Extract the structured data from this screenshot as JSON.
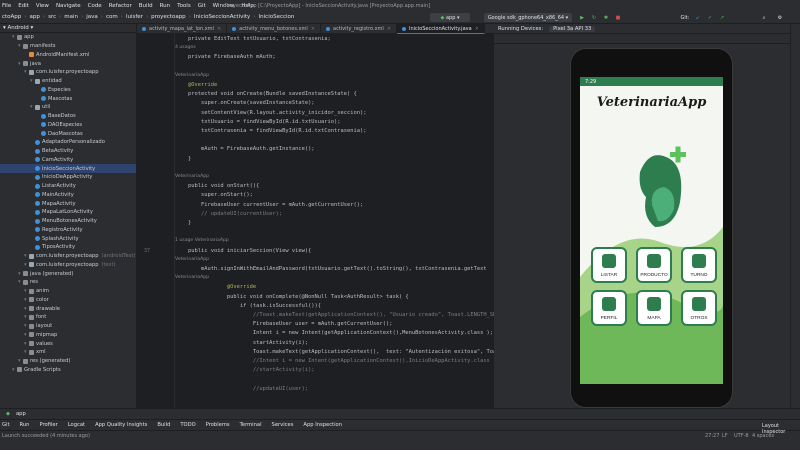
{
  "menubar": {
    "items": [
      "ctoApp",
      "app",
      "src",
      "main",
      "java",
      "com",
      "luisfer",
      "proyectoapp",
      "InicioSeccionActivity",
      "InicioSeccion"
    ],
    "title": "ProyectoApp [C:\\ProyectoApp] - InicioSeccionActivity.java [ProyectoApp.app.main]"
  },
  "menus": [
    "File",
    "Edit",
    "View",
    "Navigate",
    "Code",
    "Refactor",
    "Build",
    "Run",
    "Tools",
    "Git",
    "Window",
    "Help"
  ],
  "toolbar": {
    "crumbs": [
      "ctoApp",
      "app",
      "src",
      "main",
      "java",
      "com",
      "luisfer",
      "proyectoapp",
      "InicioSeccionActivity",
      "InicioSeccion"
    ],
    "run_config": "app",
    "device": "Google sdk_gphone64_x86_64",
    "git_label": "Git:"
  },
  "project": {
    "view": "Android",
    "items": [
      {
        "label": "app",
        "icon": "f",
        "indent": 0
      },
      {
        "label": "manifests",
        "icon": "f",
        "indent": 1
      },
      {
        "label": "AndroidManifest.xml",
        "icon": "xm",
        "indent": 2
      },
      {
        "label": "java",
        "icon": "f",
        "indent": 1
      },
      {
        "label": "com.luisfer.proyectoapp",
        "icon": "pk",
        "indent": 2
      },
      {
        "label": "entidad",
        "icon": "pk",
        "indent": 3
      },
      {
        "label": "Especies",
        "icon": "cl",
        "indent": 4
      },
      {
        "label": "Mascotas",
        "icon": "cl",
        "indent": 4
      },
      {
        "label": "util",
        "icon": "pk",
        "indent": 3
      },
      {
        "label": "BaseDatos",
        "icon": "cl",
        "indent": 4
      },
      {
        "label": "DAOEspecies",
        "icon": "cl",
        "indent": 4
      },
      {
        "label": "DaoMascotas",
        "icon": "cl",
        "indent": 4
      },
      {
        "label": "AdaptadorPersonalizado",
        "icon": "cl",
        "indent": 3
      },
      {
        "label": "BetaActivity",
        "icon": "cl",
        "indent": 3
      },
      {
        "label": "CamActivity",
        "icon": "cl",
        "indent": 3
      },
      {
        "label": "InicioSeccionActivity",
        "icon": "cl",
        "indent": 3,
        "selected": true
      },
      {
        "label": "InicioDeAppActivity",
        "icon": "cl",
        "indent": 3
      },
      {
        "label": "ListarActivity",
        "icon": "cl",
        "indent": 3
      },
      {
        "label": "MainActivity",
        "icon": "cl",
        "indent": 3
      },
      {
        "label": "MapaActivity",
        "icon": "cl",
        "indent": 3
      },
      {
        "label": "MapaLatLonActivity",
        "icon": "cl",
        "indent": 3
      },
      {
        "label": "MenuBotonesActivity",
        "icon": "cl",
        "indent": 3
      },
      {
        "label": "RegistroActivity",
        "icon": "cl",
        "indent": 3
      },
      {
        "label": "SplashActivity",
        "icon": "cl",
        "indent": 3
      },
      {
        "label": "TiposActivity",
        "icon": "cl",
        "indent": 3
      },
      {
        "label": "com.luisfer.proyectoapp",
        "icon": "pk",
        "indent": 2,
        "suffix": "(androidTest)"
      },
      {
        "label": "com.luisfer.proyectoapp",
        "icon": "pk",
        "indent": 2,
        "suffix": "(test)"
      },
      {
        "label": "java (generated)",
        "icon": "f",
        "indent": 1
      },
      {
        "label": "res",
        "icon": "f",
        "indent": 1
      },
      {
        "label": "anim",
        "icon": "f",
        "indent": 2
      },
      {
        "label": "color",
        "icon": "f",
        "indent": 2
      },
      {
        "label": "drawable",
        "icon": "f",
        "indent": 2
      },
      {
        "label": "font",
        "icon": "f",
        "indent": 2
      },
      {
        "label": "layout",
        "icon": "f",
        "indent": 2
      },
      {
        "label": "mipmap",
        "icon": "f",
        "indent": 2
      },
      {
        "label": "values",
        "icon": "f",
        "indent": 2
      },
      {
        "label": "xml",
        "icon": "f",
        "indent": 2
      },
      {
        "label": "res (generated)",
        "icon": "f",
        "indent": 1
      },
      {
        "label": "Gradle Scripts",
        "icon": "f",
        "indent": 0
      }
    ]
  },
  "tabs": [
    {
      "label": "activity_mapa_lat_lon.xml",
      "active": false
    },
    {
      "label": "activity_menu_botones.xml",
      "active": false
    },
    {
      "label": "activity_registro.xml",
      "active": false
    },
    {
      "label": "InicioSeccionActivity.java",
      "active": true
    }
  ],
  "code": [
    {
      "n": "",
      "t": "    private EditText txtUsuario, txtContrasenia;"
    },
    {
      "n": "",
      "hint": "4 usages"
    },
    {
      "n": "",
      "t": "    private FirebaseAuth mAuth;"
    },
    {
      "n": "",
      "t": ""
    },
    {
      "n": "",
      "hint": "VeterinariaApp"
    },
    {
      "n": "",
      "t": "    @Override"
    },
    {
      "n": "",
      "t": "    protected void onCreate(Bundle savedInstanceState) {"
    },
    {
      "n": "",
      "t": "        super.onCreate(savedInstanceState);"
    },
    {
      "n": "",
      "t": "        setContentView(R.layout.activity_inicidor_seccion);"
    },
    {
      "n": "",
      "t": "        txtUsuario = findViewById(R.id.txtUsuario);"
    },
    {
      "n": "",
      "t": "        txtContrasenia = findViewById(R.id.txtContrasenia);"
    },
    {
      "n": "",
      "t": ""
    },
    {
      "n": "",
      "t": "        mAuth = FirebaseAuth.getInstance();"
    },
    {
      "n": "",
      "t": "    }"
    },
    {
      "n": "",
      "t": ""
    },
    {
      "n": "",
      "hint": "VeterinariaApp"
    },
    {
      "n": "",
      "t": "    public void onStart(){"
    },
    {
      "n": "",
      "t": "        super.onStart();"
    },
    {
      "n": "",
      "t": "        FirebaseUser currentUser = mAuth.getCurrentUser();"
    },
    {
      "n": "",
      "t": "        // updateUI(currentUser);"
    },
    {
      "n": "",
      "t": "    }"
    },
    {
      "n": "",
      "t": ""
    },
    {
      "n": "",
      "hint": "1 usage   VeterinariaApp"
    },
    {
      "n": "37",
      "t": "    public void iniciarSeccion(View view){"
    },
    {
      "n": "",
      "hint": "VeterinariaApp"
    },
    {
      "n": "",
      "t": "        mAuth.signInWithEmailAndPassword(txtUsuario.getText().toString(), txtContrasenia.getText"
    },
    {
      "n": "",
      "hint": "VeterinariaApp"
    },
    {
      "n": "",
      "t": "                @Override"
    },
    {
      "n": "",
      "t": "                public void onComplete(@NonNull Task<AuthResult> task) {"
    },
    {
      "n": "",
      "t": "                    if (task.isSuccessful()){"
    },
    {
      "n": "",
      "t": "                        //Toast.makeText(getApplicationContext(), \"Usuario creado\", Toast.LENGTH_SH"
    },
    {
      "n": "",
      "t": "                        FirebaseUser user = mAuth.getCurrentUser();"
    },
    {
      "n": "",
      "t": "                        Intent i = new Intent(getApplicationContext(),MenuBotonesActivity.class );"
    },
    {
      "n": "",
      "t": "                        startActivity(i);"
    },
    {
      "n": "",
      "t": "                        Toast.makeText(getApplicationContext(),  text: \"Autentización exitosa\", Toast."
    },
    {
      "n": "",
      "t": "                        //Intent i = new Intent(getApplicationContext(),InicioDeAppActivity.class )"
    },
    {
      "n": "",
      "t": "                        //startActivity(i);"
    },
    {
      "n": "",
      "t": ""
    },
    {
      "n": "",
      "t": "                        //updateUI(user);"
    }
  ],
  "emulator": {
    "running_label": "Running Devices:",
    "device_tab": "Pixel 3a API 33",
    "phone": {
      "time": "7:29",
      "app_title": "VeterinariaApp",
      "tiles": [
        {
          "label": "LISTAR",
          "icon": "list-icon"
        },
        {
          "label": "PRODUCTO",
          "icon": "store-icon"
        },
        {
          "label": "TURNO",
          "icon": "calendar-icon"
        },
        {
          "label": "PERFIL",
          "icon": "person-icon"
        },
        {
          "label": "MAPA",
          "icon": "map-pin-icon"
        },
        {
          "label": "OTROS",
          "icon": "target-icon"
        }
      ]
    }
  },
  "bottom_tools": [
    "Git",
    "Run",
    "Profiler",
    "Logcat",
    "App Quality Insights",
    "Build",
    "TODO",
    "Problems",
    "Terminal",
    "Services",
    "App Inspection"
  ],
  "run_tab": "app",
  "status": {
    "left": "Launch succeeded (4 minutes ago)",
    "position": "27:27",
    "line_sep": "LF",
    "encoding": "UTF-8",
    "indent": "4 spaces",
    "right": "Layout Inspector"
  },
  "colors": {
    "ide_bg": "#2b2d30",
    "editor_bg": "#1e1f22",
    "accent": "#3574f0",
    "app_green": "#2e7d4f"
  }
}
